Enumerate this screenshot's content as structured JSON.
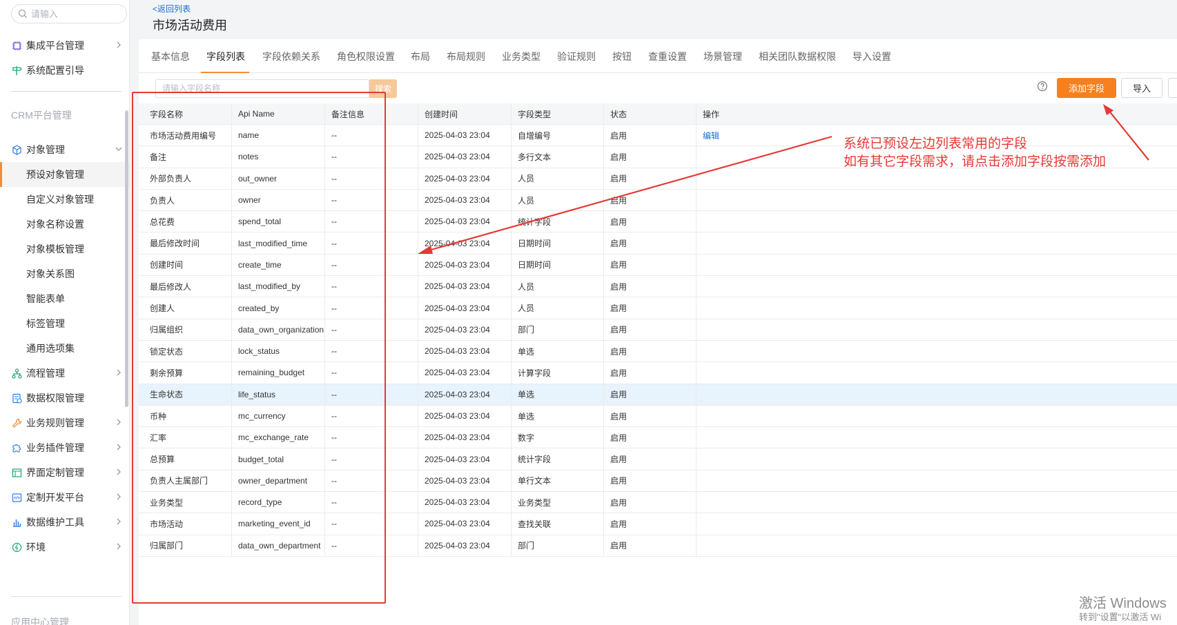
{
  "sidebar": {
    "search_placeholder": "请输入",
    "items": [
      {
        "label": "集成平台管理"
      },
      {
        "label": "系统配置引导"
      }
    ],
    "section_title": "CRM平台管理",
    "object_manage": "对象管理",
    "sub_items": [
      {
        "label": "预设对象管理"
      },
      {
        "label": "自定义对象管理"
      },
      {
        "label": "对象名称设置"
      },
      {
        "label": "对象模板管理"
      },
      {
        "label": "对象关系图"
      },
      {
        "label": "智能表单"
      },
      {
        "label": "标签管理"
      },
      {
        "label": "通用选项集"
      }
    ],
    "more_items": [
      {
        "label": "流程管理"
      },
      {
        "label": "数据权限管理"
      },
      {
        "label": "业务规则管理"
      },
      {
        "label": "业务插件管理"
      },
      {
        "label": "界面定制管理"
      },
      {
        "label": "定制开发平台"
      },
      {
        "label": "数据维护工具"
      },
      {
        "label": "环境"
      }
    ],
    "bottom_section": "应用中心管理"
  },
  "header": {
    "back_label": "<返回列表",
    "title": "市场活动费用"
  },
  "tabs": [
    "基本信息",
    "字段列表",
    "字段依赖关系",
    "角色权限设置",
    "布局",
    "布局规则",
    "业务类型",
    "验证规则",
    "按钮",
    "查重设置",
    "场景管理",
    "相关团队数据权限",
    "导入设置"
  ],
  "toolbar": {
    "search_placeholder": "请输入字段名称",
    "search_label": "搜索",
    "add_label": "添加字段",
    "import_label": "导入"
  },
  "table": {
    "columns": [
      "字段名称",
      "Api Name",
      "备注信息",
      "创建时间",
      "字段类型",
      "状态",
      "操作"
    ],
    "rows": [
      [
        "市场活动费用编号",
        "name",
        "--",
        "2025-04-03 23:04",
        "自增编号",
        "启用",
        "编辑"
      ],
      [
        "备注",
        "notes",
        "--",
        "2025-04-03 23:04",
        "多行文本",
        "启用",
        ""
      ],
      [
        "外部负责人",
        "out_owner",
        "--",
        "2025-04-03 23:04",
        "人员",
        "启用",
        ""
      ],
      [
        "负责人",
        "owner",
        "--",
        "2025-04-03 23:04",
        "人员",
        "启用",
        ""
      ],
      [
        "总花费",
        "spend_total",
        "--",
        "2025-04-03 23:04",
        "统计字段",
        "启用",
        ""
      ],
      [
        "最后修改时间",
        "last_modified_time",
        "--",
        "2025-04-03 23:04",
        "日期时间",
        "启用",
        ""
      ],
      [
        "创建时间",
        "create_time",
        "--",
        "2025-04-03 23:04",
        "日期时间",
        "启用",
        ""
      ],
      [
        "最后修改人",
        "last_modified_by",
        "--",
        "2025-04-03 23:04",
        "人员",
        "启用",
        ""
      ],
      [
        "创建人",
        "created_by",
        "--",
        "2025-04-03 23:04",
        "人员",
        "启用",
        ""
      ],
      [
        "归属组织",
        "data_own_organization",
        "--",
        "2025-04-03 23:04",
        "部门",
        "启用",
        ""
      ],
      [
        "锁定状态",
        "lock_status",
        "--",
        "2025-04-03 23:04",
        "单选",
        "启用",
        ""
      ],
      [
        "剩余预算",
        "remaining_budget",
        "--",
        "2025-04-03 23:04",
        "计算字段",
        "启用",
        ""
      ],
      [
        "生命状态",
        "life_status",
        "--",
        "2025-04-03 23:04",
        "单选",
        "启用",
        ""
      ],
      [
        "币种",
        "mc_currency",
        "--",
        "2025-04-03 23:04",
        "单选",
        "启用",
        ""
      ],
      [
        "汇率",
        "mc_exchange_rate",
        "--",
        "2025-04-03 23:04",
        "数字",
        "启用",
        ""
      ],
      [
        "总预算",
        "budget_total",
        "--",
        "2025-04-03 23:04",
        "统计字段",
        "启用",
        ""
      ],
      [
        "负责人主属部门",
        "owner_department",
        "--",
        "2025-04-03 23:04",
        "单行文本",
        "启用",
        ""
      ],
      [
        "业务类型",
        "record_type",
        "--",
        "2025-04-03 23:04",
        "业务类型",
        "启用",
        ""
      ],
      [
        "市场活动",
        "marketing_event_id",
        "--",
        "2025-04-03 23:04",
        "查找关联",
        "启用",
        ""
      ],
      [
        "归属部门",
        "data_own_department",
        "--",
        "2025-04-03 23:04",
        "部门",
        "启用",
        ""
      ]
    ]
  },
  "annotation": {
    "line1": "系统已预设左边列表常用的字段",
    "line2": "如有其它字段需求，请点击添加字段按需添加"
  },
  "watermark": {
    "line1": "激活 Windows",
    "line2": "转到\"设置\"以激活 Wi"
  },
  "colors": {
    "accent": "#f7801e",
    "link": "#1a6fd6",
    "annotation": "#e53935"
  }
}
